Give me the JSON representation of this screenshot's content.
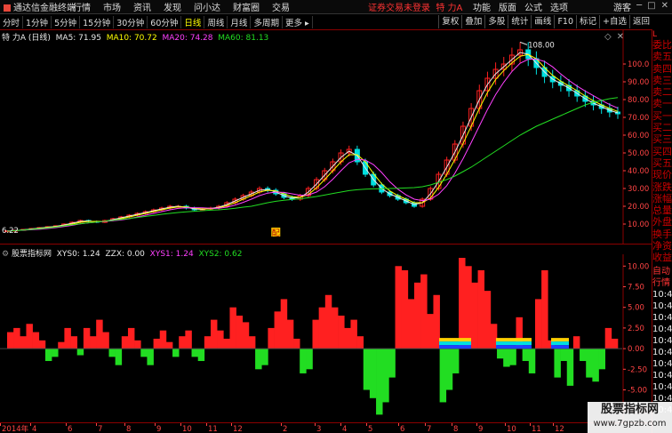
{
  "topbar": {
    "app_name": "通达信金融终端",
    "menu": [
      "行情",
      "市场",
      "资讯",
      "发现",
      "问小达",
      "财富圈",
      "交易"
    ],
    "notice": "证券交易未登录",
    "stock_short": "特 力A",
    "right_menu": [
      "功能",
      "版面",
      "公式",
      "选项"
    ],
    "user": "游客"
  },
  "periods": [
    "分时",
    "1分钟",
    "5分钟",
    "15分钟",
    "30分钟",
    "60分钟",
    "日线",
    "周线",
    "月线",
    "多周期",
    "更多"
  ],
  "active_period": "日线",
  "tools": [
    "复权",
    "叠加",
    "多股",
    "统计",
    "画线",
    "F10",
    "标记",
    "+自选",
    "返回"
  ],
  "main_panel": {
    "stock_title": "特 力A (日线)",
    "ma_labels": [
      {
        "text": "MA5: 71.95",
        "color": "#e8e8e8"
      },
      {
        "text": "MA10: 70.72",
        "color": "#ffff00"
      },
      {
        "text": "MA20: 74.28",
        "color": "#ff40ff"
      },
      {
        "text": "MA60: 81.13",
        "color": "#22dd22"
      }
    ],
    "high_label": "108.00",
    "low_label": "6.22",
    "marker_label": "配"
  },
  "indicator_panel": {
    "title": "股票指标网",
    "values": [
      {
        "text": "XYS0: 1.24",
        "color": "#e8e8e8"
      },
      {
        "text": "ZZX: 0.00",
        "color": "#e8e8e8"
      },
      {
        "text": "XYS1: 1.24",
        "color": "#ff40ff"
      },
      {
        "text": "XYS2: 0.62",
        "color": "#22dd22"
      }
    ]
  },
  "price_axis": [
    "100.0",
    "90.00",
    "80.00",
    "70.00",
    "60.00",
    "50.00",
    "40.00",
    "30.00",
    "20.00",
    "10.00"
  ],
  "indicator_axis": [
    "10.00",
    "7.50",
    "5.00",
    "2.50",
    "0.00",
    "-2.50",
    "-5.00",
    "-7.50"
  ],
  "x_axis": [
    "2014年",
    "4",
    "6",
    "7",
    "8",
    "9",
    "10",
    "11",
    "12",
    "2",
    "3",
    "4",
    "5",
    "6",
    "7",
    "8",
    "9",
    "10",
    "11",
    "12"
  ],
  "sidebar": {
    "header": "L",
    "quote_items": [
      "委比",
      "卖五",
      "卖四",
      "卖三",
      "卖二",
      "卖一",
      "买一",
      "买二",
      "买三",
      "买四",
      "买五",
      "现价",
      "涨跌",
      "涨幅",
      "总量",
      "外盘",
      "换手",
      "净资",
      "收益"
    ],
    "tick_items": [
      "自动",
      "行情",
      "10:4",
      "10:4",
      "10:4",
      "10:4",
      "10:4",
      "10:4",
      "10:4",
      "10:4",
      "10:4",
      "10:4",
      "10:4"
    ]
  },
  "watermark": {
    "title": "股票指标网",
    "url": "www.7gpzb.com"
  },
  "colors": {
    "up": "#ff2020",
    "down": "#22dd22",
    "ma5": "#e8e8e8",
    "ma10": "#ffff00",
    "ma20": "#ff40ff",
    "ma60": "#22dd22",
    "axis": "#ff4444",
    "separator": "#8b0000"
  },
  "chart_data": {
    "type": "candlestick",
    "main": {
      "ylim": [
        0,
        110
      ],
      "close": [
        6.2,
        6.5,
        7,
        7.5,
        8,
        8.5,
        9,
        10,
        11,
        12,
        11.5,
        11,
        12,
        13,
        14,
        15,
        16,
        17,
        18,
        19,
        20,
        20,
        19,
        18,
        18.5,
        19,
        20,
        22,
        24,
        26,
        28,
        30,
        29,
        27,
        25,
        24,
        26,
        30,
        35,
        40,
        45,
        50,
        52,
        45,
        38,
        32,
        28,
        26,
        24,
        22,
        20,
        24,
        30,
        38,
        46,
        55,
        65,
        75,
        85,
        92,
        97,
        100,
        105,
        108,
        103,
        98,
        93,
        90,
        88,
        85,
        82,
        79,
        77,
        75,
        73,
        72
      ],
      "ma60": [
        6,
        6.3,
        6.6,
        7,
        7.4,
        7.8,
        8.3,
        9,
        9.6,
        10.2,
        10.7,
        11.1,
        11.6,
        12.1,
        12.6,
        13.1,
        13.7,
        14.3,
        14.9,
        15.5,
        16,
        16.5,
        16.9,
        17.2,
        17.5,
        17.8,
        18,
        18.4,
        18.9,
        19.5,
        20,
        21,
        22,
        22.8,
        23.4,
        23.8,
        24.2,
        24.8,
        25.5,
        26.3,
        27.2,
        28,
        28.8,
        29.3,
        29.6,
        29.8,
        29.9,
        30,
        30.1,
        30.3,
        30.5,
        31,
        32,
        33.5,
        35,
        37,
        39.5,
        42,
        45,
        48,
        51,
        54,
        57,
        60,
        62.5,
        65,
        67,
        69,
        71,
        73,
        75,
        77,
        78.5,
        79.5,
        80.5,
        81.1
      ]
    },
    "indicator": {
      "ylim": [
        -8.5,
        11
      ],
      "values": [
        2,
        2.5,
        1.5,
        3,
        2,
        1,
        -1.5,
        -1,
        0.8,
        2.5,
        1.5,
        -0.8,
        2.5,
        1.5,
        3.5,
        2,
        -1,
        -2,
        1.5,
        2.5,
        1,
        -1,
        -2,
        1.2,
        2.2,
        0.8,
        -1,
        1.5,
        2.2,
        -1,
        -1.5,
        1.5,
        3.5,
        2.2,
        1.2,
        5,
        4,
        3.2,
        1.5,
        -2.5,
        -2,
        2.5,
        4.5,
        6,
        3.5,
        1.2,
        -3,
        -2.5,
        3.5,
        5,
        6.5,
        5,
        4,
        2.5,
        3.5,
        1.5,
        -5,
        -6,
        -8,
        -6.5,
        -3.5,
        10,
        9.5,
        6,
        8,
        9,
        4.2,
        6.5,
        -6.5,
        -5,
        -3,
        11,
        10,
        8,
        9.5,
        7,
        3,
        -1.2,
        -2.2,
        -2,
        3.8,
        -1.5,
        -3,
        6,
        9.5,
        1,
        -3.5,
        -1.5,
        -4.5,
        1.5,
        -1.5,
        -3.5,
        -4,
        -2.5,
        2.5,
        1.2
      ]
    }
  }
}
